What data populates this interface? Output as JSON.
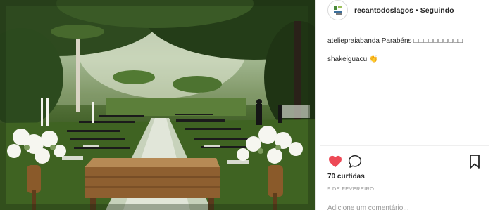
{
  "post": {
    "image_alt": "",
    "username": "recantodoslagos",
    "separator": "•",
    "follow_status": "Seguindo",
    "comments": [
      {
        "user": "ateliepraiabanda",
        "text": "Parabéns",
        "emoji": "□□□□□□□□□□"
      },
      {
        "user": "shakeiguacu",
        "text": "",
        "emoji": "👏"
      }
    ],
    "likes_text": "70 curtidas",
    "date": "9 DE FEVEREIRO",
    "comment_placeholder": "Adicione um comentário..."
  },
  "colors": {
    "like_red": "#ed4956",
    "text_dark": "#262626",
    "text_muted": "#999999",
    "border": "#efefef"
  },
  "icons": [
    "app-logo-icon",
    "heart-icon",
    "comment-icon",
    "bookmark-icon"
  ]
}
